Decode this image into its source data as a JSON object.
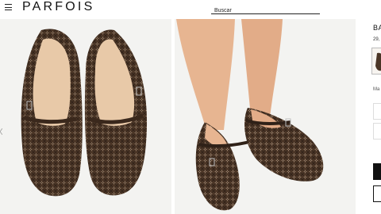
{
  "header": {
    "logo": "PARFOIS",
    "search_placeholder": "Buscar"
  },
  "gallery": {
    "images": [
      {
        "alt": "Woven brown Mary Jane flats, top view"
      },
      {
        "alt": "Model wearing woven brown Mary Jane flats"
      }
    ]
  },
  "product": {
    "title": "BA",
    "price": "29,",
    "color_label": "Ma"
  },
  "colors": {
    "shoe": "#4a3526",
    "shoe_dark": "#2f2118",
    "lining": "#e8c9a8",
    "skin": "#e7b591",
    "background": "#f3f3f1"
  }
}
